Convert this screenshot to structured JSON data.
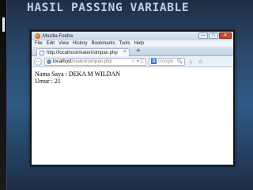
{
  "slide": {
    "title": "HASIL PASSING VARIABLE"
  },
  "browser": {
    "window_title": "Mozilla Firefox",
    "menu": [
      "File",
      "Edit",
      "View",
      "History",
      "Bookmarks",
      "Tools",
      "Help"
    ],
    "tab": {
      "label": "http://localhost/materi/simpan.php",
      "close": "×"
    },
    "new_tab": "+",
    "url": {
      "host": "localhost",
      "path": "/materi/simpan.php",
      "tools": "☆ ▾ C"
    },
    "search": {
      "engine": "g",
      "placeholder": "Google",
      "icon": "🔍"
    },
    "controls": {
      "min": "—",
      "max": "□",
      "close": "✕"
    },
    "icons": {
      "back": "back-arrow-icon",
      "home": "home-icon",
      "download": "download-icon"
    }
  },
  "page": {
    "line1": "Nama Saya : DEKA M WILDAN",
    "line2": "Umur : 21"
  }
}
